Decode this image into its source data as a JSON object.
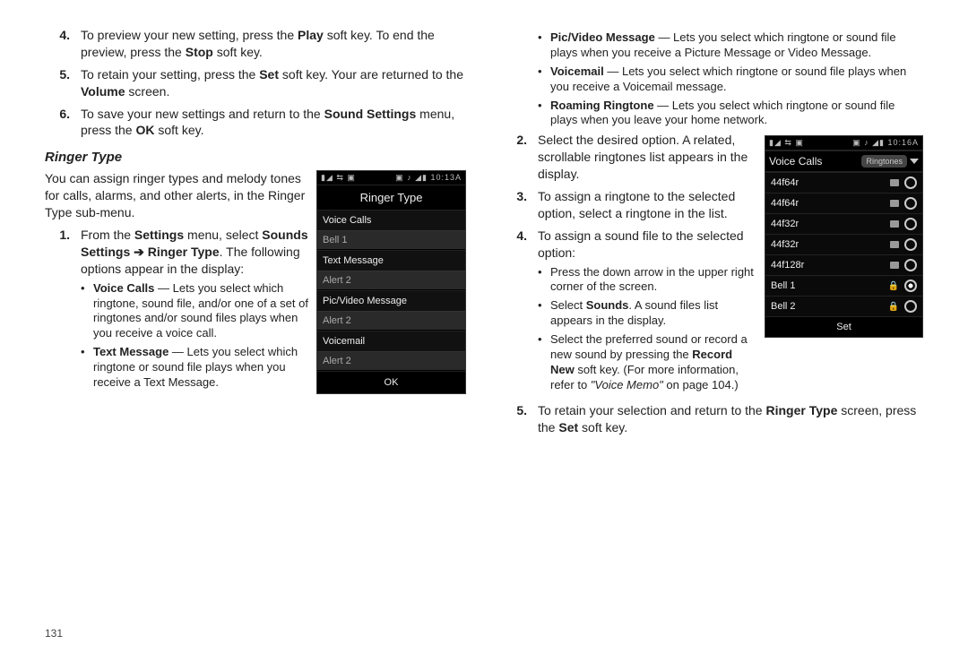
{
  "left": {
    "steps_top": [
      {
        "n": "4.",
        "html": "To preview your new setting, press the <b>Play</b> soft key. To end the preview, press the <b>Stop</b> soft key."
      },
      {
        "n": "5.",
        "html": "To retain your setting, press the <b>Set</b> soft key. Your are returned to the <b>Volume</b> screen."
      },
      {
        "n": "6.",
        "html": "To save your new settings and return to the <b>Sound Settings</b> menu, press the <b>OK</b> soft key."
      }
    ],
    "section": "Ringer Type",
    "intro": "You can assign ringer types and melody tones for calls, alarms, and other alerts, in the Ringer Type sub-menu.",
    "step1": {
      "n": "1.",
      "lead": "From the <b>Settings</b> menu, select <b>Sounds Settings ➔ Ringer Type</b>. The following options appear in the display:",
      "bullets": [
        "<b>Voice Calls</b> — Lets you select which ringtone, sound file, and/or one of a set of ringtones and/or sound files plays when you receive a voice call.",
        "<b>Text Message</b> — Lets you select which ringtone or sound file plays when you receive a Text Message."
      ]
    },
    "phone1": {
      "status_left": "▮◢  ⇆ ▣",
      "status_right": "▣ ♪ ◢▮ 10:13A",
      "title": "Ringer Type",
      "rows": [
        {
          "label": "Voice Calls",
          "value": "Bell 1"
        },
        {
          "label": "Text Message",
          "value": "Alert 2"
        },
        {
          "label": "Pic/Video Message",
          "value": "Alert 2"
        },
        {
          "label": "Voicemail",
          "value": "Alert 2"
        }
      ],
      "ok": "OK"
    },
    "page": "131"
  },
  "right": {
    "top_bullets": [
      "<b>Pic/Video Message</b> — Lets you select which ringtone or sound file plays when you receive a Picture Message or Video Message.",
      "<b>Voicemail</b> — Lets you select which ringtone or sound file plays when you receive a Voicemail message.",
      "<b>Roaming Ringtone</b> — Lets you select which ringtone or sound file plays when you leave your home network."
    ],
    "steps": [
      {
        "n": "2.",
        "html": "Select the desired option. A related, scrollable ringtones list appears in the display."
      },
      {
        "n": "3.",
        "html": "To assign a ringtone to the selected option, select a ringtone in the list."
      },
      {
        "n": "4.",
        "html": "To assign a sound file to the selected option:",
        "bullets": [
          "Press the down arrow in the upper right corner of the screen.",
          "Select <b>Sounds</b>. A sound files list appears in the display.",
          "Select the preferred sound or record a new sound by pressing the <b>Record New</b> soft key. (For more information, refer to <i class=\"ref\">\"Voice Memo\"</i> on page 104.)"
        ]
      },
      {
        "n": "5.",
        "html": "To retain your selection and return to the <b>Ringer Type</b> screen, press the <b>Set</b> soft key."
      }
    ],
    "phone2": {
      "status_left": "▮◢  ⇆ ▣",
      "status_right": "▣ ♪ ◢▮ 10:16A",
      "vc_label": "Voice Calls",
      "pill": "Ringtones",
      "items": [
        {
          "name": "44f64r",
          "badge": true,
          "selected": false
        },
        {
          "name": "44f64r",
          "badge": true,
          "selected": false
        },
        {
          "name": "44f32r",
          "badge": true,
          "selected": false
        },
        {
          "name": "44f32r",
          "badge": true,
          "selected": false
        },
        {
          "name": "44f128r",
          "badge": true,
          "selected": false
        },
        {
          "name": "Bell 1",
          "lock": true,
          "selected": true
        },
        {
          "name": "Bell 2",
          "lock": true,
          "selected": false
        }
      ],
      "set": "Set"
    }
  }
}
